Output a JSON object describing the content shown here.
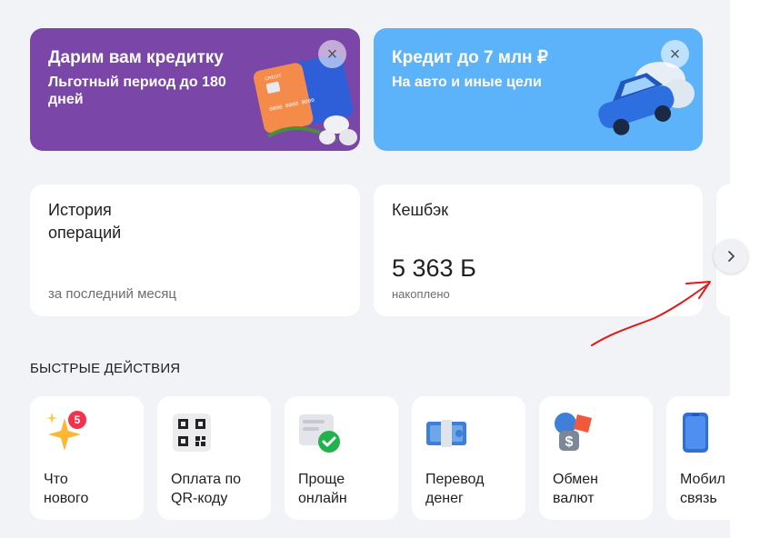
{
  "banners": [
    {
      "title": "Дарим вам кредитку",
      "subtitle": "Льготный период до 180 дней",
      "color": "#7a47a8"
    },
    {
      "title": "Кредит до 7 млн ₽",
      "subtitle": "На авто и иные цели",
      "color": "#5cb3fa"
    }
  ],
  "cards": {
    "history": {
      "title": "История операций",
      "footer": "за последний месяц"
    },
    "cashback": {
      "title": "Кешбэк",
      "value": "5 363 Б",
      "note": "накоплено"
    }
  },
  "quick_actions": {
    "title": "БЫСТРЫЕ ДЕЙСТВИЯ",
    "items": [
      {
        "label": "Что\nнового",
        "icon": "sparkles-icon",
        "badge": "5"
      },
      {
        "label": "Оплата по\nQR-коду",
        "icon": "qr-code-icon"
      },
      {
        "label": "Проще\nонлайн",
        "icon": "form-check-icon"
      },
      {
        "label": "Перевод\nденег",
        "icon": "money-transfer-icon"
      },
      {
        "label": "Обмен\nвалют",
        "icon": "currency-exchange-icon"
      },
      {
        "label": "Мобил\nсвязь",
        "icon": "mobile-phone-icon"
      }
    ]
  },
  "colors": {
    "accent_red": "#f2334b",
    "background": "#f2f3f7"
  }
}
